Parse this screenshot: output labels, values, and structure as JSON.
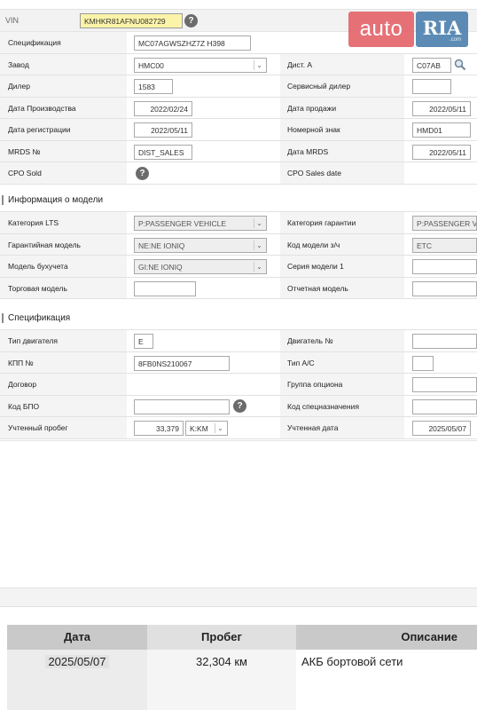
{
  "vin": {
    "label": "VIN",
    "value": "KMHKR81AFNU082729"
  },
  "logo": {
    "auto": "auto",
    "ria": "RIA",
    "com": ".com"
  },
  "general": {
    "spec": {
      "label": "Спецификация",
      "value": "MC07AGWSZHZ7Z  H398"
    },
    "plant": {
      "label": "Завод",
      "value": "HMC00"
    },
    "dist": {
      "label": "Дист. А",
      "value": "C07AB"
    },
    "dealer": {
      "label": "Дилер",
      "value": "1583"
    },
    "service_dealer": {
      "label": "Сервисный дилер",
      "value": ""
    },
    "prod_date": {
      "label": "Дата Производства",
      "value": "2022/02/24"
    },
    "sale_date": {
      "label": "Дата продажи",
      "value": "2022/05/11"
    },
    "reg_date": {
      "label": "Дата регистрации",
      "value": "2022/05/11"
    },
    "plate": {
      "label": "Номерной знак",
      "value": "HMD01"
    },
    "mrds_no": {
      "label": "MRDS №",
      "value": "DIST_SALES"
    },
    "mrds_date": {
      "label": "Дата MRDS",
      "value": "2022/05/11"
    },
    "cpo_sold": {
      "label": "CPO Sold"
    },
    "cpo_sales_date": {
      "label": "CPO Sales date",
      "value": ""
    }
  },
  "model_info": {
    "title": "Информация о модели",
    "lts_category": {
      "label": "Категория LTS",
      "value": "P:PASSENGER VEHICLE"
    },
    "warranty_category": {
      "label": "Категория гарантии",
      "value": "P:PASSENGER VEHI"
    },
    "warranty_model": {
      "label": "Гарантийная модель",
      "value": "NE:NE IONIQ"
    },
    "parts_model_code": {
      "label": "Код модели з/ч",
      "value": "ETC"
    },
    "accounting_model": {
      "label": "Модель бухучета",
      "value": "GI:NE IONIQ"
    },
    "model_series": {
      "label": "Серия модели 1",
      "value": ""
    },
    "trade_model": {
      "label": "Торговая модель",
      "value": ""
    },
    "report_model": {
      "label": "Отчетная модель",
      "value": ""
    }
  },
  "spec": {
    "title": "Спецификация",
    "engine_type": {
      "label": "Тип двигателя",
      "value": "E"
    },
    "engine_no": {
      "label": "Двигатель №",
      "value": ""
    },
    "gearbox_no": {
      "label": "КПП №",
      "value": "8FB0NS210067"
    },
    "ac_type": {
      "label": "Тип A/C",
      "value": ""
    },
    "contract": {
      "label": "Договор"
    },
    "option_group": {
      "label": "Группа опциона",
      "value": ""
    },
    "bpo_code": {
      "label": "Код БПО",
      "value": ""
    },
    "special_code": {
      "label": "Код спецназначения",
      "value": ""
    },
    "mileage": {
      "label": "Учтенный пробег",
      "value": "33,379",
      "unit": "K:KM"
    },
    "mileage_date": {
      "label": "Учтенная дата",
      "value": "2025/05/07"
    }
  },
  "history": {
    "headers": [
      "Дата",
      "Пробег",
      "Описание"
    ],
    "rows": [
      {
        "date": "2025/05/07",
        "mileage": "32,304 км",
        "description": "АКБ бортовой сети"
      }
    ]
  },
  "icons": [
    "help-icon",
    "magnifier-icon",
    "chevron-down-icon"
  ]
}
